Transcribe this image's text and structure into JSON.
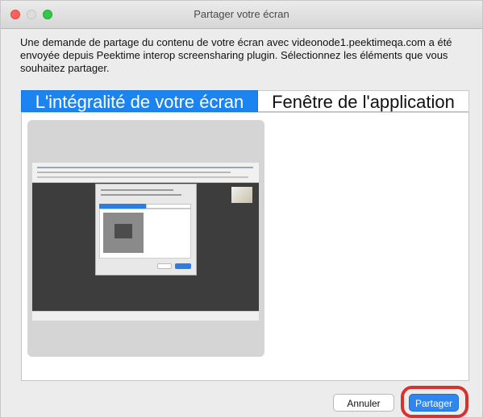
{
  "window": {
    "title": "Partager votre écran"
  },
  "message": "Une demande de partage du contenu de votre écran avec videonode1.peektimeqa.com a été envoyée depuis Peektime interop screensharing plugin. Sélectionnez les éléments que vous souhaitez partager.",
  "tabs": [
    {
      "label": "L'intégralité de votre écran",
      "selected": true
    },
    {
      "label": "Fenêtre de l'application",
      "selected": false
    }
  ],
  "buttons": {
    "cancel_label": "Annuler",
    "share_label": "Partager"
  },
  "colors": {
    "accent": "#1c84f0",
    "highlight": "#d8322f"
  }
}
